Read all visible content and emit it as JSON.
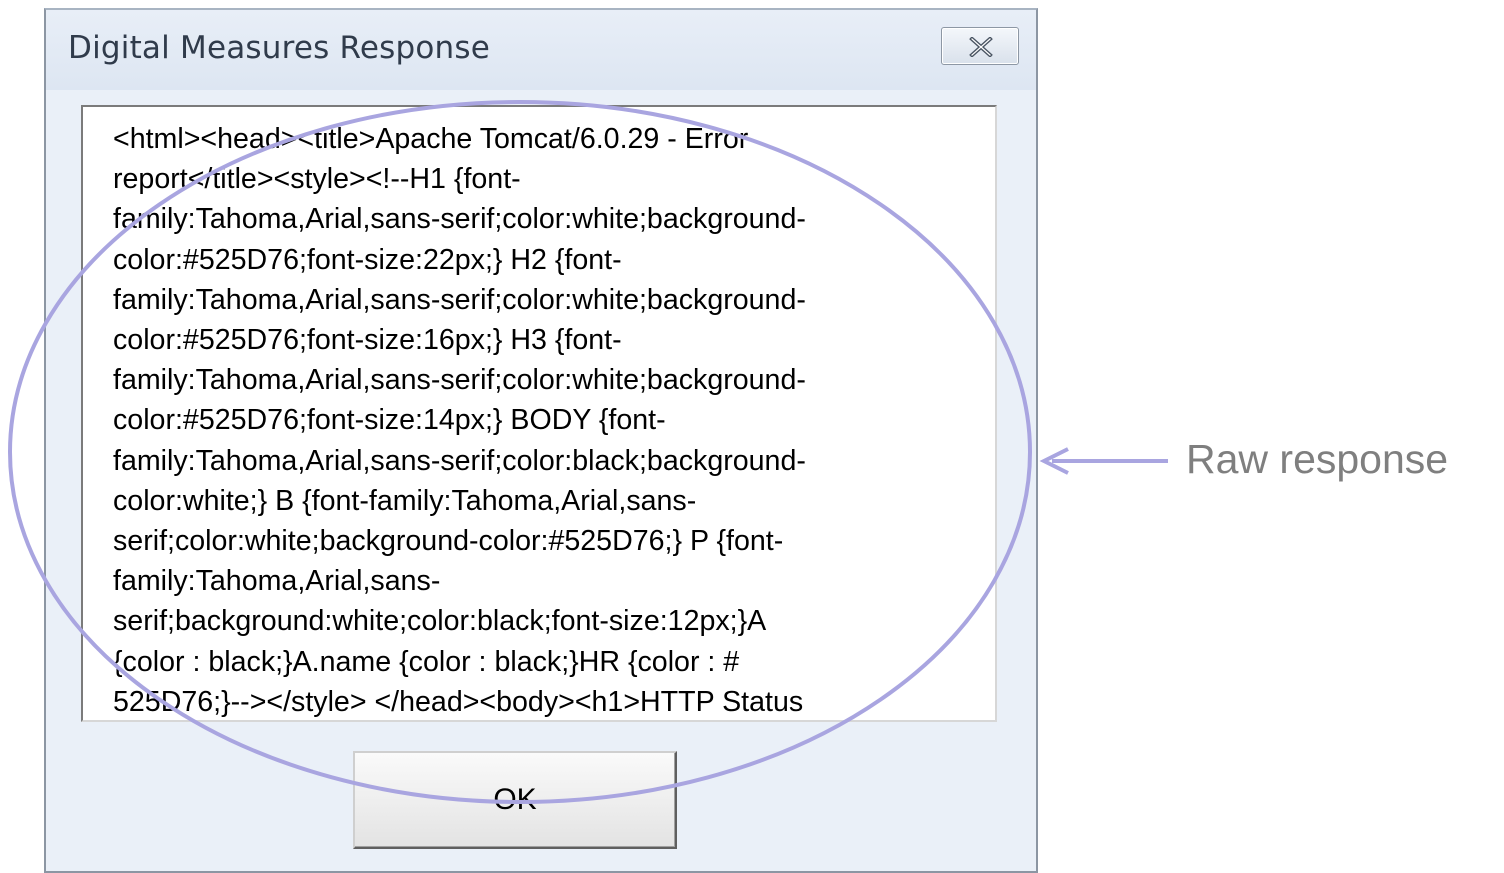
{
  "dialog": {
    "title": "Digital Measures Response",
    "response_text": "<html><head><title>Apache Tomcat/6.0.29 - Error\nreport</title><style><!--H1 {font-\nfamily:Tahoma,Arial,sans-serif;color:white;background-\ncolor:#525D76;font-size:22px;} H2 {font-\nfamily:Tahoma,Arial,sans-serif;color:white;background-\ncolor:#525D76;font-size:16px;} H3 {font-\nfamily:Tahoma,Arial,sans-serif;color:white;background-\ncolor:#525D76;font-size:14px;} BODY {font-\nfamily:Tahoma,Arial,sans-serif;color:black;background-\ncolor:white;} B {font-family:Tahoma,Arial,sans-\nserif;color:white;background-color:#525D76;} P {font-\nfamily:Tahoma,Arial,sans-\nserif;background:white;color:black;font-size:12px;}A\n{color : black;}A.name {color : black;}HR {color : #\n525D76;}--></style> </head><body><h1>HTTP Status",
    "ok_label": "OK",
    "close_icon": "close-x-icon"
  },
  "annotation": {
    "label": "Raw response",
    "color": "#a9a5e0"
  }
}
